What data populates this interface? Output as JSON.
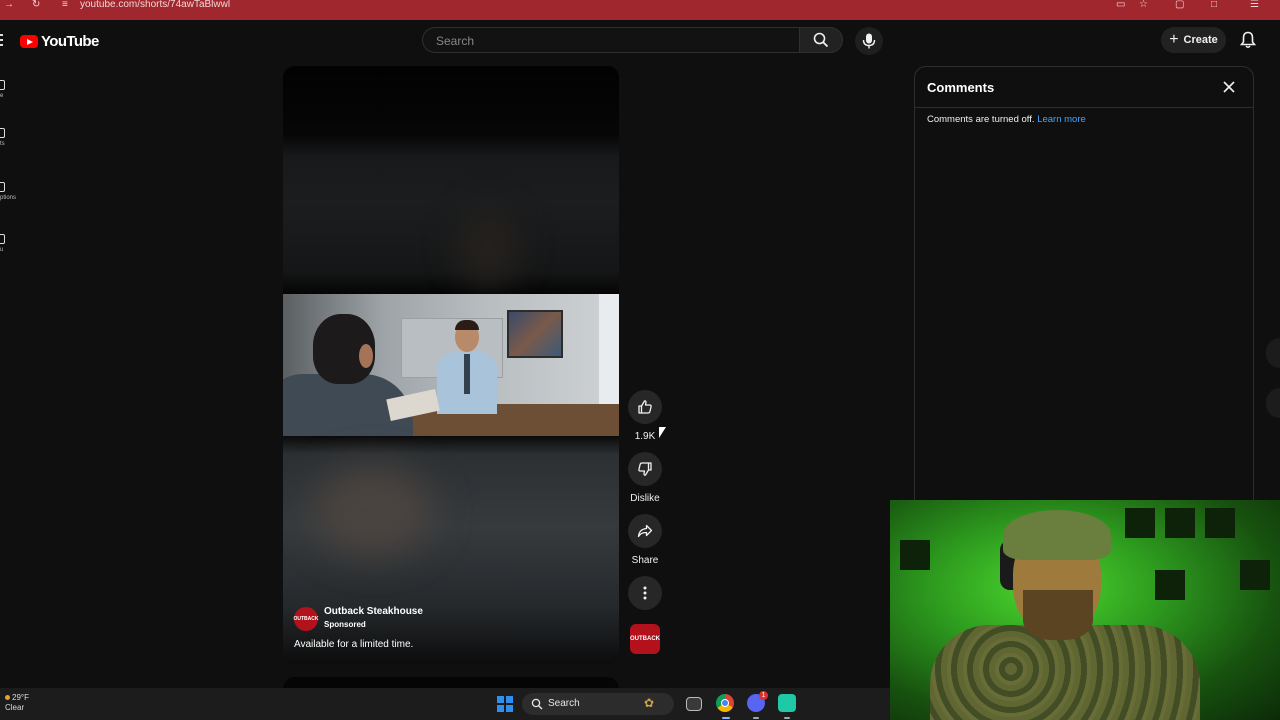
{
  "browser": {
    "url": "youtube.com/shorts/74awTaBlwwl"
  },
  "header": {
    "logo_text": "YouTube",
    "search_placeholder": "Search",
    "create_label": "Create"
  },
  "sidebar": {
    "items": [
      {
        "label": "e"
      },
      {
        "label": "ts"
      },
      {
        "label": "ptions"
      },
      {
        "label": "u"
      }
    ]
  },
  "video": {
    "channel_name": "Outback Steakhouse",
    "channel_avatar_text": "OUTBACK",
    "sponsored_label": "Sponsored",
    "caption": "Available for a limited time."
  },
  "actions": {
    "like_count": "1.9K",
    "dislike_label": "Dislike",
    "share_label": "Share",
    "channel_thumb_text": "OUTBACK"
  },
  "comments": {
    "title": "Comments",
    "message": "Comments are turned off.",
    "learn_more": "Learn more"
  },
  "taskbar": {
    "temperature": "29°F",
    "condition": "Clear",
    "search_label": "Search",
    "discord_badge": "1"
  },
  "colors": {
    "brand_red": "#ff0000",
    "link_blue": "#3ea6ff",
    "background": "#0f0f0f",
    "browser_bar": "#a0272e"
  },
  "icons": [
    "menu-icon",
    "youtube-logo-icon",
    "search-icon",
    "microphone-icon",
    "plus-icon",
    "bell-icon",
    "like-icon",
    "dislike-icon",
    "share-icon",
    "more-icon",
    "close-icon",
    "windows-start-icon",
    "chrome-icon",
    "discord-icon"
  ]
}
